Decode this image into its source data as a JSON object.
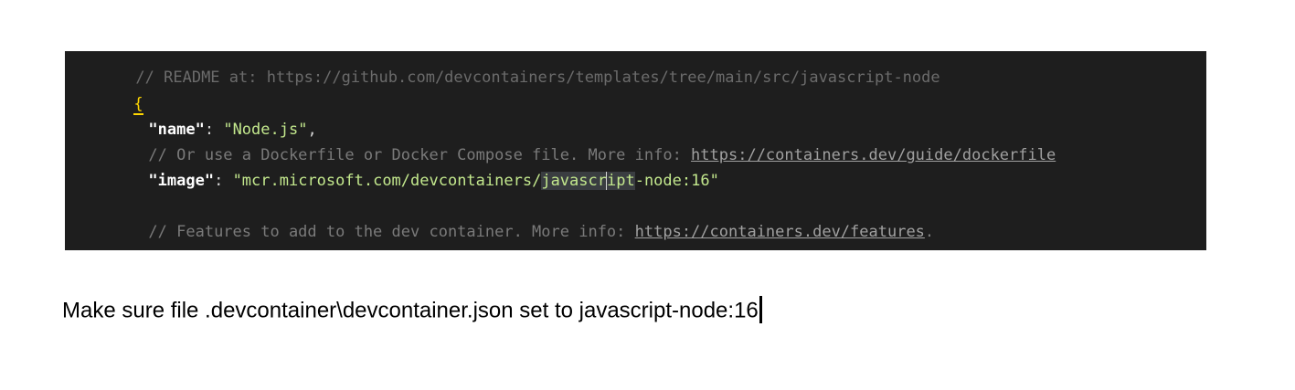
{
  "editor": {
    "cut_line": "// README at: https://github.com/devcontainers/templates/tree/main/src/javascript-node",
    "open_brace": "{",
    "name_key": "\"name\"",
    "name_sep": ": ",
    "name_value": "\"Node.js\"",
    "name_comma": ",",
    "comment1_text": "// Or use a Dockerfile or Docker Compose file. More info: ",
    "comment1_link": "https://containers.dev/guide/dockerfile",
    "image_key": "\"image\"",
    "image_sep": ": ",
    "image_value_prefix": "\"mcr.microsoft.com/devcontainers/",
    "image_value_hl_a": "javascr",
    "image_value_hl_b": "ipt",
    "image_value_suffix": "-node:16\"",
    "comment2_text": "// Features to add to the dev container. More info: ",
    "comment2_link": "https://containers.dev/features",
    "comment2_end": "."
  },
  "caption": {
    "text": "Make sure file .devcontainer\\devcontainer.json set to javascript-node:16"
  },
  "colors": {
    "editor_bg": "#1e1e1e",
    "key": "#9cdcfe",
    "string": "#ce9178",
    "comment": "#7a7a7a",
    "brace": "#ffd700"
  }
}
